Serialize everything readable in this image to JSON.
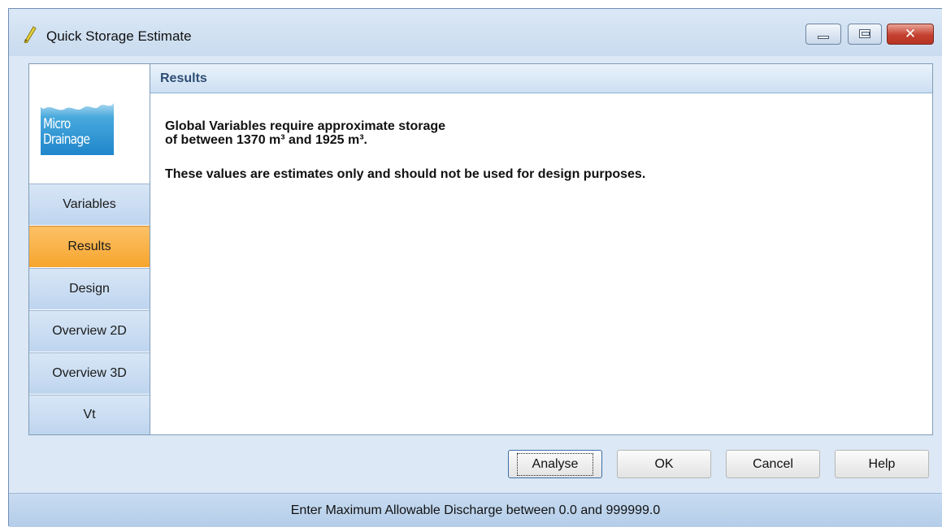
{
  "window": {
    "title": "Quick Storage Estimate",
    "controls": {
      "minimize": "minimize",
      "maximize": "maximize",
      "close": "✕"
    }
  },
  "logo": {
    "line1": "Micro",
    "line2": "Drainage"
  },
  "sidebar": {
    "items": [
      {
        "label": "Variables",
        "active": false
      },
      {
        "label": "Results",
        "active": true
      },
      {
        "label": "Design",
        "active": false
      },
      {
        "label": "Overview 2D",
        "active": false
      },
      {
        "label": "Overview 3D",
        "active": false
      },
      {
        "label": "Vt",
        "active": false
      }
    ]
  },
  "results": {
    "header": "Results",
    "line1": "Global Variables require approximate storage",
    "line2": "of between 1370 m³ and 1925 m³.",
    "line3": "These values are estimates only and should not be used for design purposes."
  },
  "buttons": {
    "analyse": "Analyse",
    "ok": "OK",
    "cancel": "Cancel",
    "help": "Help"
  },
  "status": {
    "text": "Enter Maximum Allowable Discharge between 0.0 and 999999.0"
  },
  "colors": {
    "active_tab": "#f7a52d",
    "nav_tab": "#bed5ef",
    "close_button": "#c4402f"
  }
}
